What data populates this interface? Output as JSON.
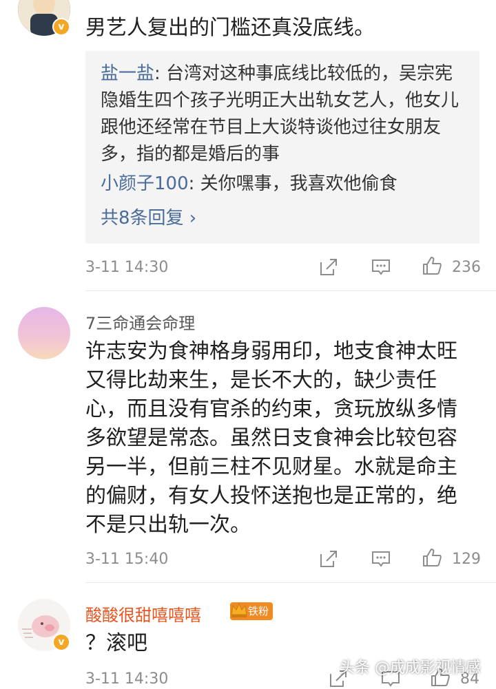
{
  "comments": [
    {
      "username": "",
      "text": "男艺人复出的门槛还真没底线。",
      "replies": [
        {
          "name": "盐一盐",
          "text": ": 台湾对这种事底线比较低的，吴宗宪隐婚生四个孩子光明正大出轨女艺人，他女儿跟他还经常在节目上大谈特谈他过往女朋友多，指的都是婚后的事"
        },
        {
          "name": "小颜子100",
          "text": ": 关你嘿事，我喜欢他偷食"
        }
      ],
      "more_replies": "共8条回复 ›",
      "time": "3-11 14:30",
      "likes": "236"
    },
    {
      "username": "7三命通会命理",
      "text": "许志安为食神格身弱用印，地支食神太旺又得比劫来生，是长不大的，缺少责任心，而且没有官杀的约束，贪玩放纵多情多欲望是常态。虽然日支食神会比较包容另一半，但前三柱不见财星。水就是命主的偏财，有女人投怀送抱也是正常的，绝不是只出轨一次。",
      "time": "3-11 15:40",
      "likes": "129"
    },
    {
      "username": "酸酸很甜嘻嘻嘻",
      "badge": "铁粉",
      "text": "？滚吧",
      "time": "3-11 14:30",
      "likes": "84"
    }
  ],
  "watermark": "头条 @成成影视情感",
  "colors": {
    "link": "#4a6c9b",
    "orange_name": "#e8541e",
    "reply_bg": "#f4f4f4",
    "meta": "#8c8c8c"
  }
}
